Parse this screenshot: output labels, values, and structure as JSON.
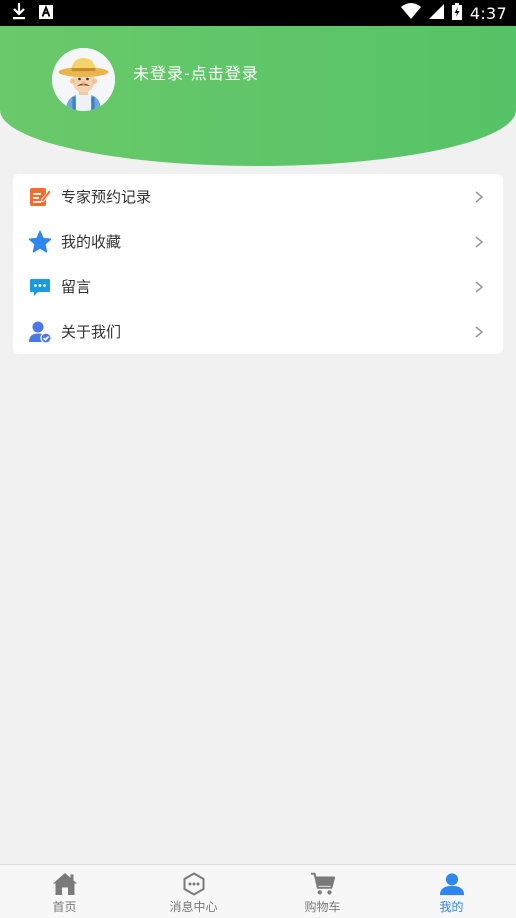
{
  "status_bar": {
    "time": "4:37",
    "left_icons": [
      "download-icon",
      "a-badge-icon"
    ],
    "right_icons": [
      "wifi-icon",
      "signal-icon",
      "battery-charging-icon"
    ]
  },
  "profile": {
    "login_prompt": "未登录-点击登录",
    "avatar": "farmer-avatar-icon"
  },
  "menu": {
    "items": [
      {
        "label": "专家预约记录",
        "icon": "notepad-edit-icon",
        "icon_color": "#f56b2b"
      },
      {
        "label": "我的收藏",
        "icon": "star-icon",
        "icon_color": "#2f86f0"
      },
      {
        "label": "留言",
        "icon": "chat-bubble-icon",
        "icon_color": "#1a9be0"
      },
      {
        "label": "关于我们",
        "icon": "user-verified-icon",
        "icon_color": "#4a78e8"
      }
    ]
  },
  "bottom_nav": {
    "items": [
      {
        "label": "首页",
        "icon": "home-icon",
        "active": false
      },
      {
        "label": "消息中心",
        "icon": "message-hexagon-icon",
        "active": false
      },
      {
        "label": "购物车",
        "icon": "cart-icon",
        "active": false
      },
      {
        "label": "我的",
        "icon": "person-icon",
        "active": true
      }
    ],
    "active_color": "#2f86f0",
    "inactive_color": "#7a7a7a"
  },
  "colors": {
    "header_green": "#5cc466",
    "background": "#f1f1f1"
  }
}
